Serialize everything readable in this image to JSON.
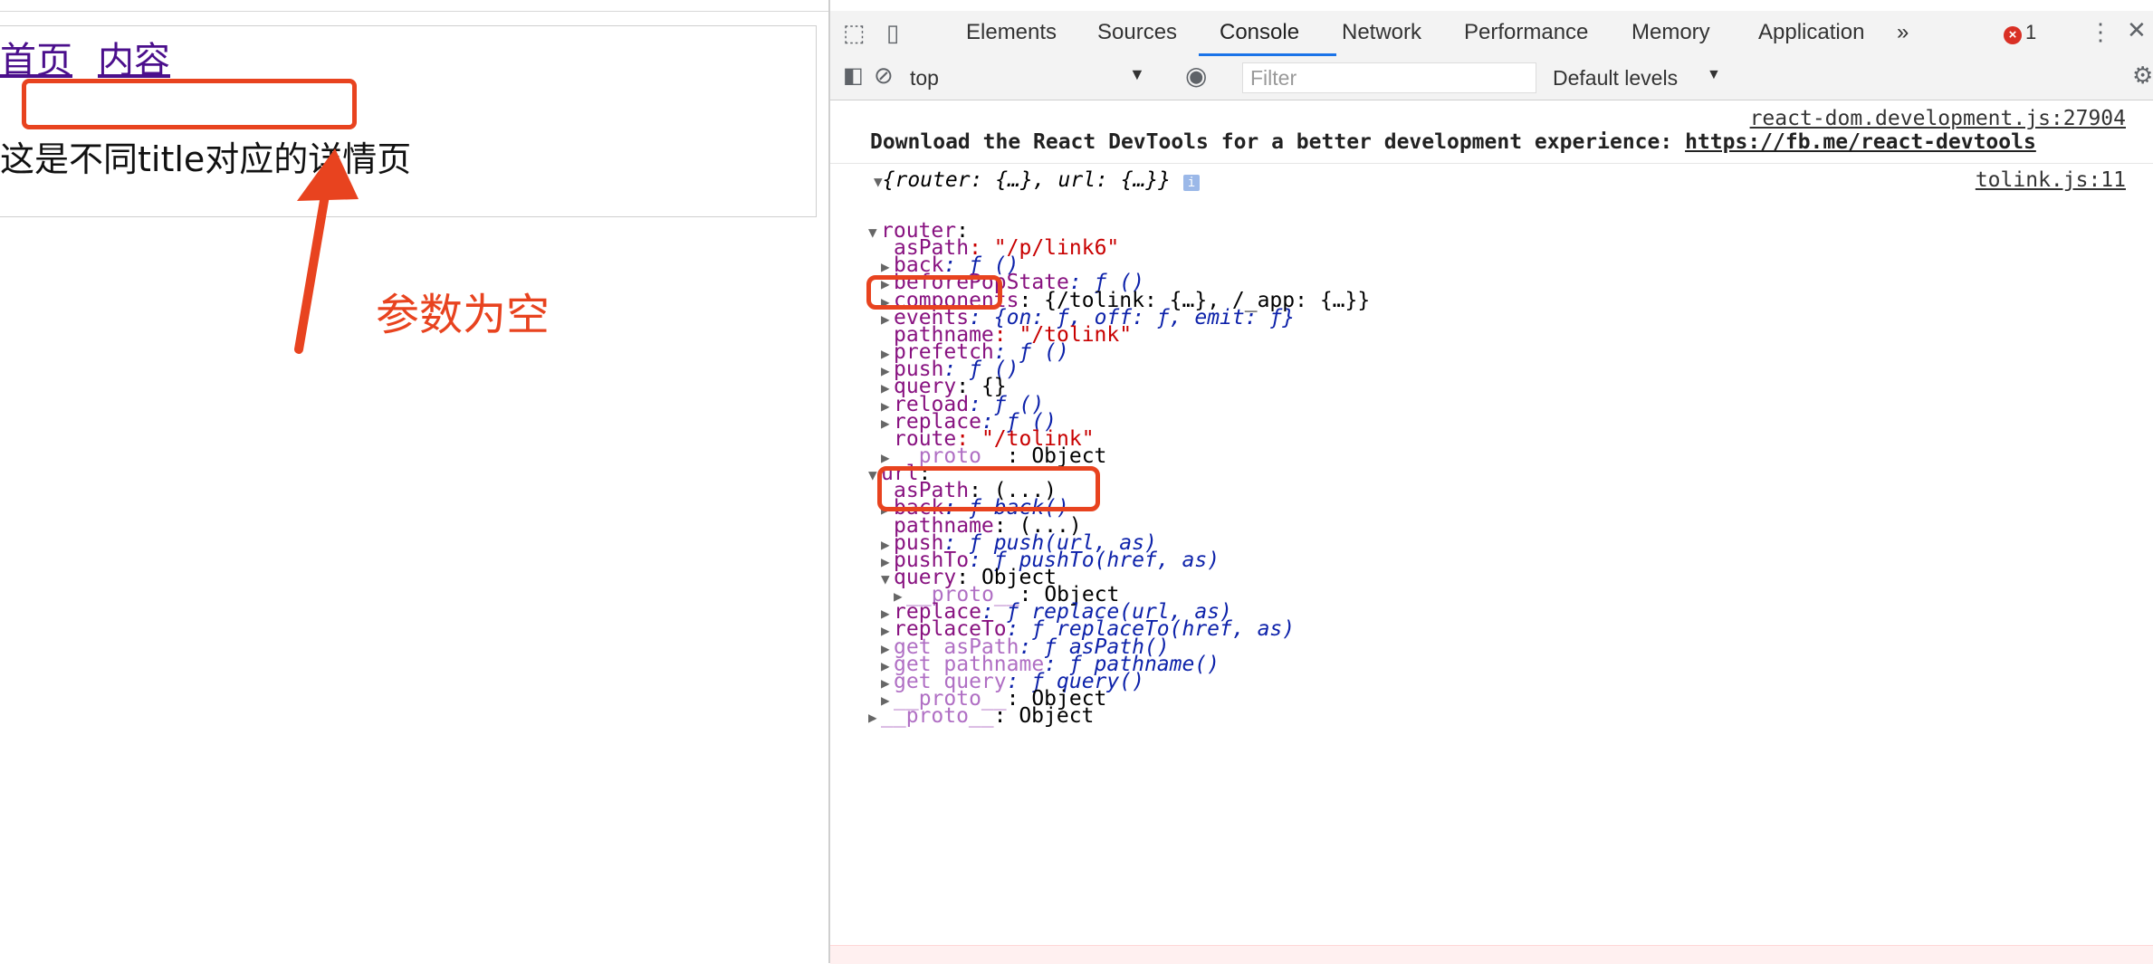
{
  "page": {
    "nav_links": [
      "首页",
      "内容"
    ],
    "detail_text": "这是不同title对应的详情页",
    "annotation": "参数为空"
  },
  "devtools": {
    "tabs": [
      "Elements",
      "Sources",
      "Console",
      "Network",
      "Performance",
      "Memory",
      "Application"
    ],
    "active_tab": "Console",
    "more_tabs": "»",
    "error_count": "1",
    "context": "top",
    "filter_placeholder": "Filter",
    "levels": "Default levels",
    "messages": {
      "react_source": "react-dom.development.js:27904",
      "react_text": "Download the React DevTools for a better development experience: ",
      "react_link": "https://fb.me/react-devtools",
      "log_source": "tolink.js:11",
      "log_summary": "{router: {…}, url: {…}}"
    },
    "tree": [
      {
        "indent": 1,
        "tri": "down",
        "key": "router",
        "rest": ":"
      },
      {
        "indent": 2,
        "tri": "none",
        "key": "asPath",
        "rest": ": \"/p/link6\""
      },
      {
        "indent": 2,
        "tri": "right",
        "key": "back",
        "rest": ": ƒ ()"
      },
      {
        "indent": 2,
        "tri": "right",
        "key": "beforePopState",
        "rest": ": ƒ ()"
      },
      {
        "indent": 2,
        "tri": "right",
        "key": "components",
        "rest": ": {/tolink: {…}, /_app: {…}}"
      },
      {
        "indent": 2,
        "tri": "right",
        "key": "events",
        "rest": ": {on: ƒ, off: ƒ, emit: ƒ}"
      },
      {
        "indent": 2,
        "tri": "none",
        "key": "pathname",
        "rest": ": \"/tolink\""
      },
      {
        "indent": 2,
        "tri": "right",
        "key": "prefetch",
        "rest": ": ƒ ()"
      },
      {
        "indent": 2,
        "tri": "right",
        "key": "push",
        "rest": ": ƒ ()"
      },
      {
        "indent": 2,
        "tri": "right",
        "key": "query",
        "rest": ": {}"
      },
      {
        "indent": 2,
        "tri": "right",
        "key": "reload",
        "rest": ": ƒ ()"
      },
      {
        "indent": 2,
        "tri": "right",
        "key": "replace",
        "rest": ": ƒ ()"
      },
      {
        "indent": 2,
        "tri": "none",
        "key": "route",
        "rest": ": \"/tolink\""
      },
      {
        "indent": 2,
        "tri": "right",
        "key": "__proto__",
        "rest": ": Object"
      },
      {
        "indent": 1,
        "tri": "down",
        "key": "url",
        "rest": ":"
      },
      {
        "indent": 2,
        "tri": "none",
        "key": "asPath",
        "rest": ": (...)"
      },
      {
        "indent": 2,
        "tri": "right",
        "key": "back",
        "rest": ": ƒ back()"
      },
      {
        "indent": 2,
        "tri": "none",
        "key": "pathname",
        "rest": ": (...)"
      },
      {
        "indent": 2,
        "tri": "right",
        "key": "push",
        "rest": ": ƒ push(url, as)"
      },
      {
        "indent": 2,
        "tri": "right",
        "key": "pushTo",
        "rest": ": ƒ pushTo(href, as)"
      },
      {
        "indent": 2,
        "tri": "down",
        "key": "query",
        "rest": ": Object"
      },
      {
        "indent": 3,
        "tri": "right",
        "key": "__proto__",
        "rest": ": Object"
      },
      {
        "indent": 2,
        "tri": "right",
        "key": "replace",
        "rest": ": ƒ replace(url, as)"
      },
      {
        "indent": 2,
        "tri": "right",
        "key": "replaceTo",
        "rest": ": ƒ replaceTo(href, as)"
      },
      {
        "indent": 2,
        "tri": "right",
        "key": "get asPath",
        "rest": ": ƒ asPath()"
      },
      {
        "indent": 2,
        "tri": "right",
        "key": "get pathname",
        "rest": ": ƒ pathname()"
      },
      {
        "indent": 2,
        "tri": "right",
        "key": "get query",
        "rest": ": ƒ query()"
      },
      {
        "indent": 2,
        "tri": "right",
        "key": "__proto__",
        "rest": ": Object"
      },
      {
        "indent": 1,
        "tri": "right",
        "key": "__proto__",
        "rest": ": Object"
      }
    ]
  },
  "colors": {
    "accent": "#e8431f",
    "link": "#4b0f8c",
    "key": "#881280",
    "string": "#c80000",
    "func": "#0d22aa"
  }
}
